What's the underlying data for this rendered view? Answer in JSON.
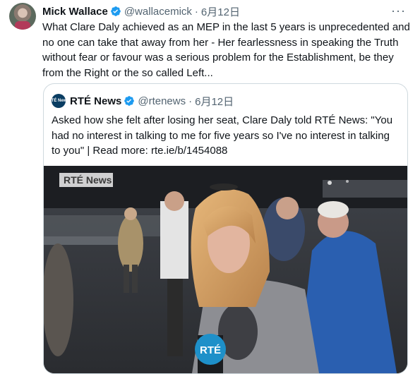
{
  "author": {
    "name": "Mick Wallace",
    "handle": "@wallacemick",
    "separator": "·",
    "date": "6月12日"
  },
  "tweet_text": "What Clare Daly achieved as an MEP in the last 5 years is unprecedented and no one can take that away from her - Her fearlessness in speaking the Truth without fear or favour was a serious problem for the Establishment, be they from the Right or the so called Left...",
  "more_label": "···",
  "quoted": {
    "name": "RTÉ News",
    "handle": "@rtenews",
    "separator": "·",
    "date": "6月12日",
    "logo_text": "RTÉ News",
    "text": "Asked how she felt after losing her seat, Clare Daly told RTÉ News: \"You had no interest in talking to me for five years so I've no interest in talking to you\" | Read more: rte.ie/b/1454088",
    "video_overlay": "RTÉ News",
    "mic_label": "RTÉ"
  },
  "colors": {
    "verified": "#1d9bf0",
    "text": "#0f1419",
    "muted": "#536471",
    "border": "#cfd9de"
  }
}
